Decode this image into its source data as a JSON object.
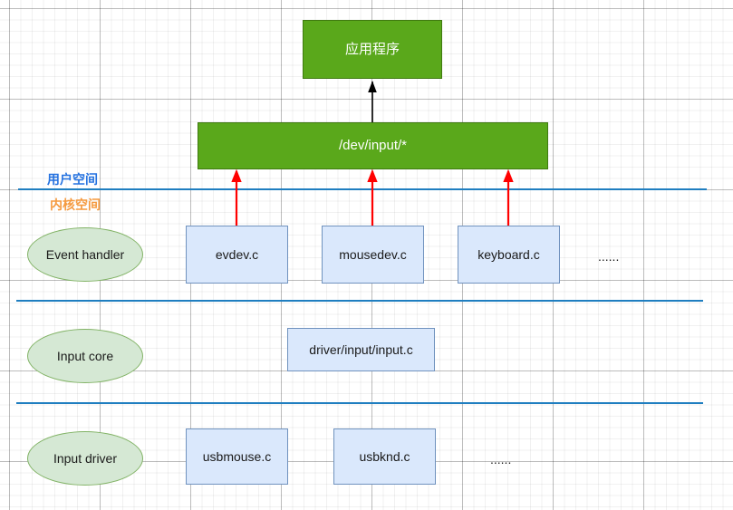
{
  "diagram": {
    "title_node": {
      "label": "应用程序"
    },
    "device_node": {
      "label": "/dev/input/*"
    },
    "space_labels": {
      "user": "用户空间",
      "kernel": "内核空间",
      "user_color": "#2673e0",
      "kernel_color": "#f59a3f"
    },
    "layers": [
      {
        "name": "event-handler",
        "group_label": "Event handler",
        "nodes": [
          {
            "label": "evdev.c"
          },
          {
            "label": "mousedev.c"
          },
          {
            "label": "keyboard.c"
          }
        ],
        "ellipsis": "......"
      },
      {
        "name": "input-core",
        "group_label": "Input core",
        "nodes": [
          {
            "label": "driver/input/input.c"
          }
        ],
        "ellipsis": ""
      },
      {
        "name": "input-driver",
        "group_label": "Input driver",
        "nodes": [
          {
            "label": "usbmouse.c"
          },
          {
            "label": "usbknd.c"
          }
        ],
        "ellipsis": "......"
      }
    ],
    "colors": {
      "green_fill": "#5aa81b",
      "green_stroke": "#3f7a10",
      "blue_fill": "#dae8fc",
      "blue_stroke": "#7092be",
      "ellipse_fill": "#d5e8d4",
      "ellipse_stroke": "#82b366",
      "divider": "#1f7ec0",
      "red_arrow": "#ff0000",
      "black_arrow": "#000000"
    }
  }
}
